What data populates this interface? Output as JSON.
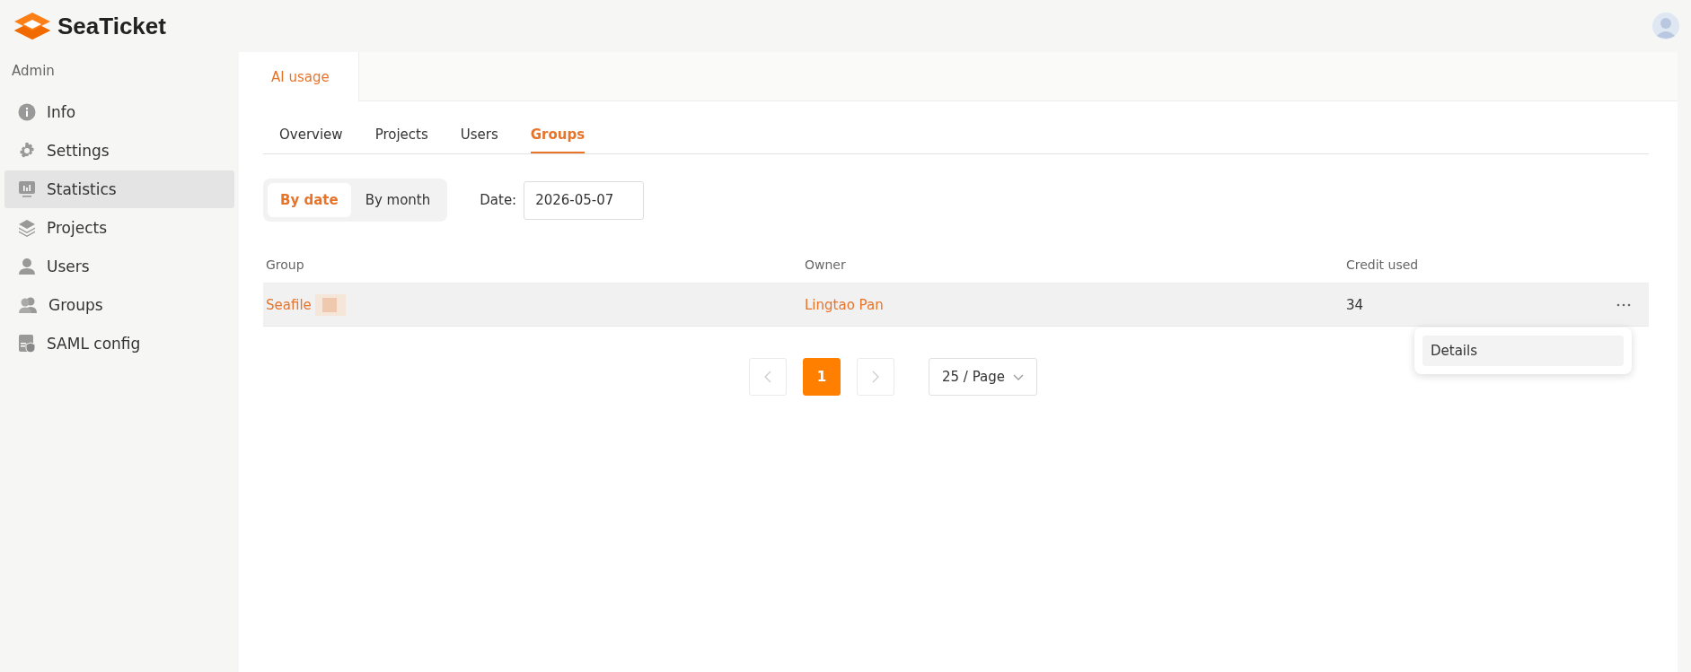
{
  "app": {
    "name": "SeaTicket"
  },
  "sidebar": {
    "heading": "Admin",
    "items": [
      {
        "label": "Info",
        "selected": false
      },
      {
        "label": "Settings",
        "selected": false
      },
      {
        "label": "Statistics",
        "selected": true
      },
      {
        "label": "Projects",
        "selected": false
      },
      {
        "label": "Users",
        "selected": false
      },
      {
        "label": "Groups",
        "selected": false
      },
      {
        "label": "SAML config",
        "selected": false
      }
    ]
  },
  "page_tabs": [
    {
      "label": "AI usage",
      "selected": true
    }
  ],
  "sub_tabs": [
    {
      "label": "Overview",
      "selected": false
    },
    {
      "label": "Projects",
      "selected": false
    },
    {
      "label": "Users",
      "selected": false
    },
    {
      "label": "Groups",
      "selected": true
    }
  ],
  "mode_toggle": [
    {
      "label": "By date",
      "selected": true
    },
    {
      "label": "By month",
      "selected": false
    }
  ],
  "date_filter": {
    "label": "Date:",
    "value": "2026-05-07"
  },
  "table": {
    "columns": [
      "Group",
      "Owner",
      "Credit used"
    ],
    "rows": [
      {
        "group": "Seafile",
        "owner": "Lingtao Pan",
        "credit_used": "34",
        "hovered": true
      }
    ]
  },
  "row_menu": {
    "items": [
      {
        "label": "Details",
        "selected": true
      }
    ]
  },
  "pagination": {
    "pages": [
      {
        "label": "1",
        "selected": true
      }
    ],
    "page_size": "25 / Page"
  }
}
